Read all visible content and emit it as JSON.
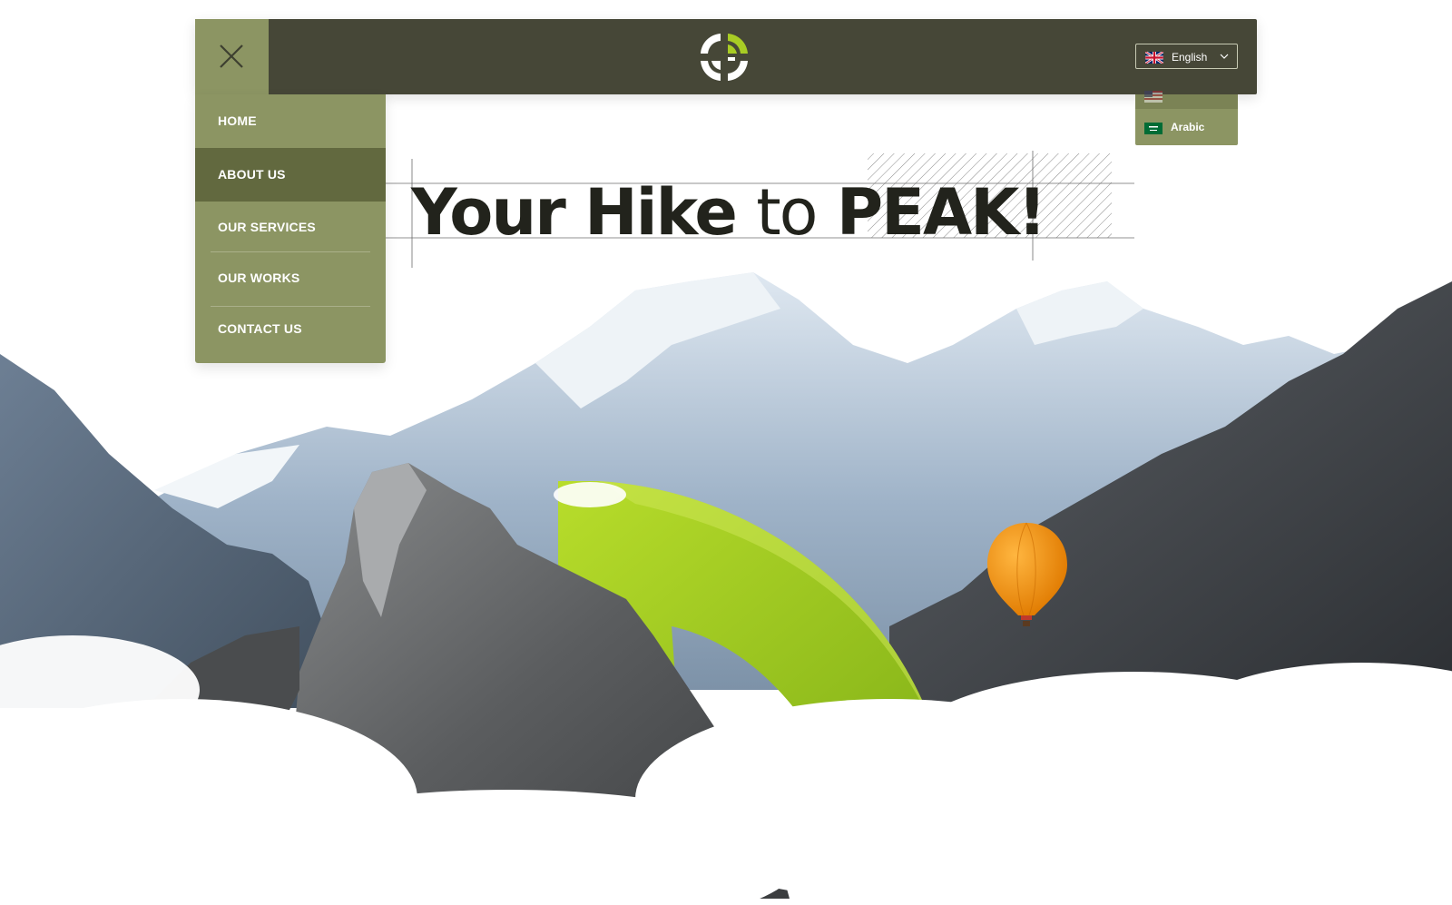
{
  "colors": {
    "header_bg": "#464737",
    "accent_olive": "#8c9563",
    "active_nav": "#62693f",
    "logo_green": "#a8cc24",
    "title": "#22231c"
  },
  "header": {
    "menu_icon": "close-icon",
    "logo_icon": "brand-logo-icon"
  },
  "language": {
    "selected": "English",
    "selected_flag": "uk-flag-icon",
    "options": [
      {
        "label": "Arabic",
        "flag": "saudi-flag-icon"
      }
    ]
  },
  "nav": {
    "items": [
      {
        "label": "HOME"
      },
      {
        "label": "ABOUT US"
      },
      {
        "label": "OUR SERVICES"
      },
      {
        "label": "OUR WORKS"
      },
      {
        "label": "CONTACT US"
      }
    ],
    "active_index": 1
  },
  "hero": {
    "title_words": [
      "Your",
      "Hike",
      "to",
      "PEAK!"
    ]
  },
  "scene": {
    "background": "mountain-landscape-image",
    "balloon": "hot-air-balloon-icon",
    "arrow": "green-arrow-graphic"
  }
}
